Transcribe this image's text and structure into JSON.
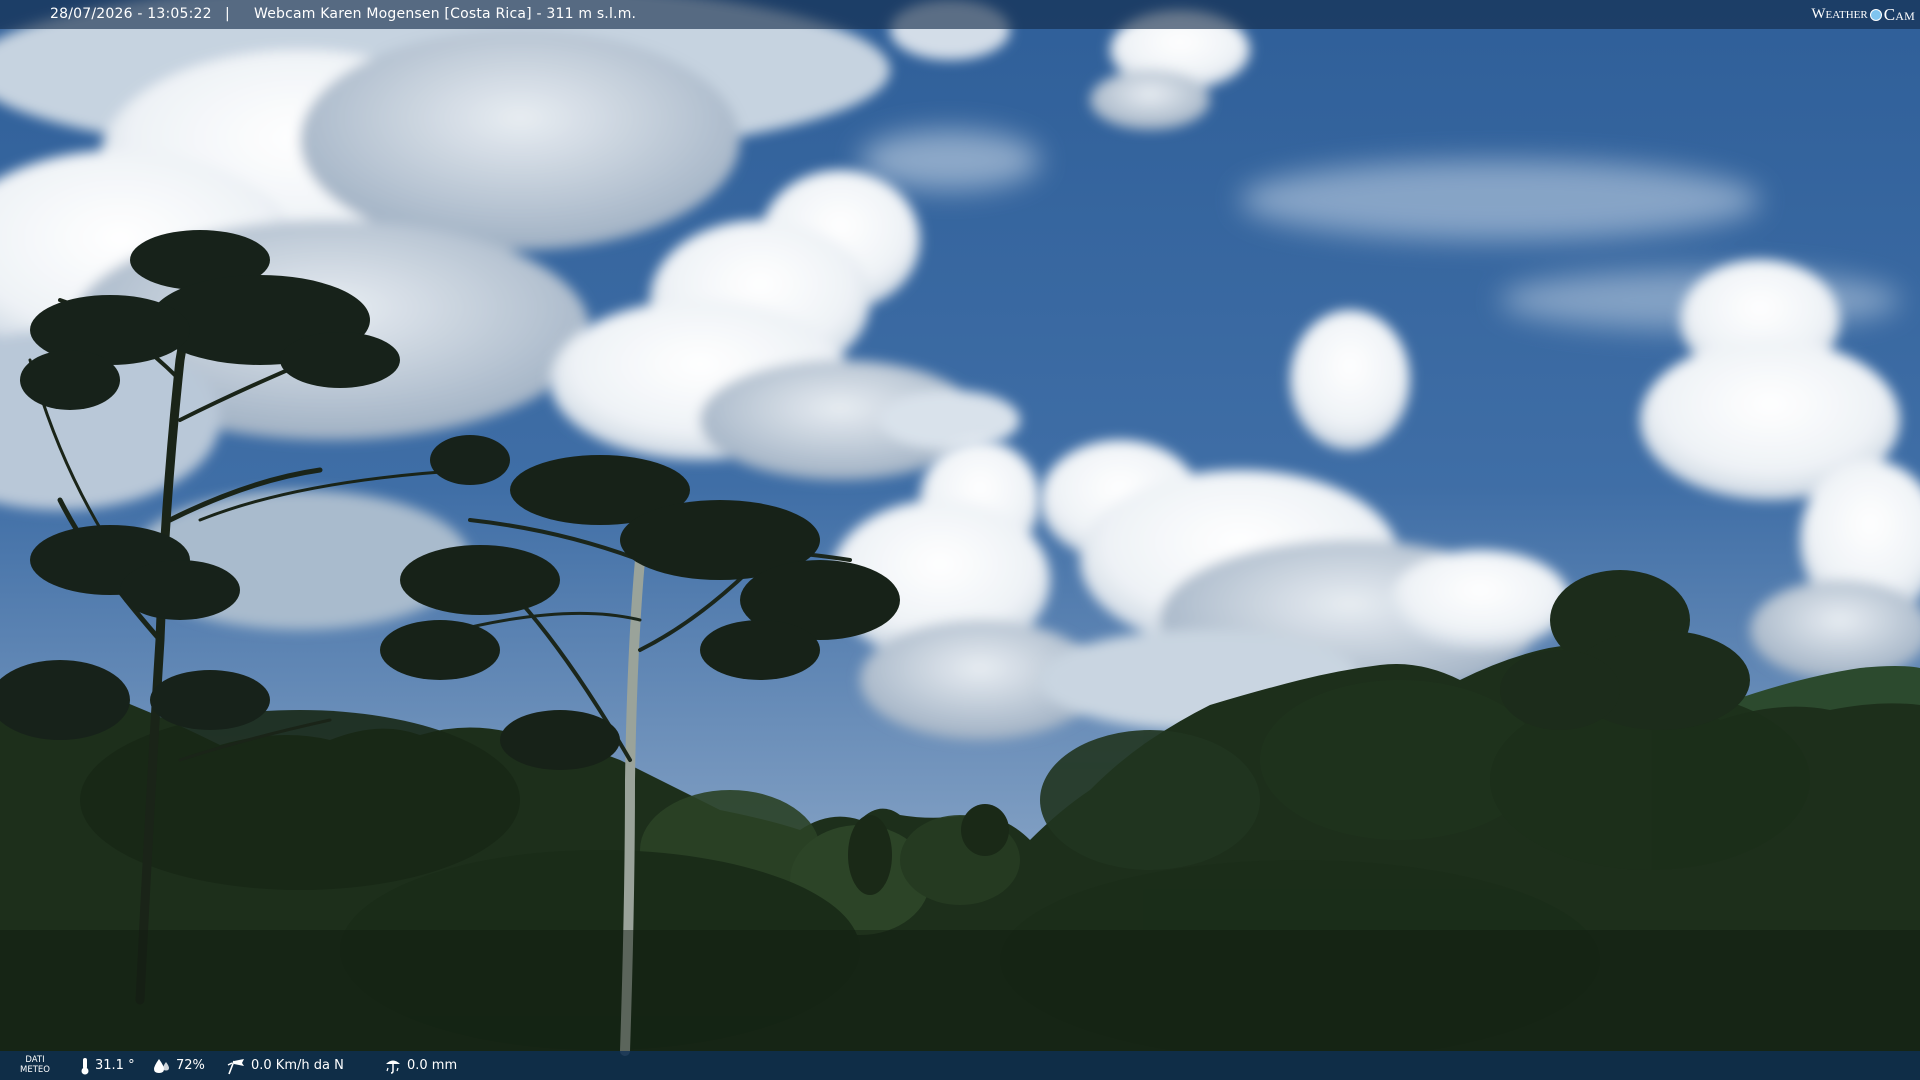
{
  "overlay": {
    "timestamp": "28/07/2026 - 13:05:22",
    "separator": "|",
    "title": "Webcam Karen Mogensen [Costa Rica]  - 311 m s.l.m.",
    "logo_left": "Weather",
    "logo_right": "Cam"
  },
  "weather_bar": {
    "label_line1": "DATI",
    "label_line2": "METEO",
    "temperature": "31.1 °",
    "humidity": "72%",
    "wind": "0.0 Km/h da N",
    "rain": "0.0 mm",
    "icons": {
      "temperature": "thermometer-icon",
      "humidity": "water-drop-icon",
      "wind": "wind-vane-icon",
      "rain": "rain-gauge-icon"
    }
  },
  "colors": {
    "sky_top": "#2f5f99",
    "sky_horizon": "#9bb5cf",
    "cloud": "#f4f7fa",
    "forest": "#1c2e1a",
    "bar_bg": "#123a60",
    "logo_dot": "#7fc4ef"
  }
}
